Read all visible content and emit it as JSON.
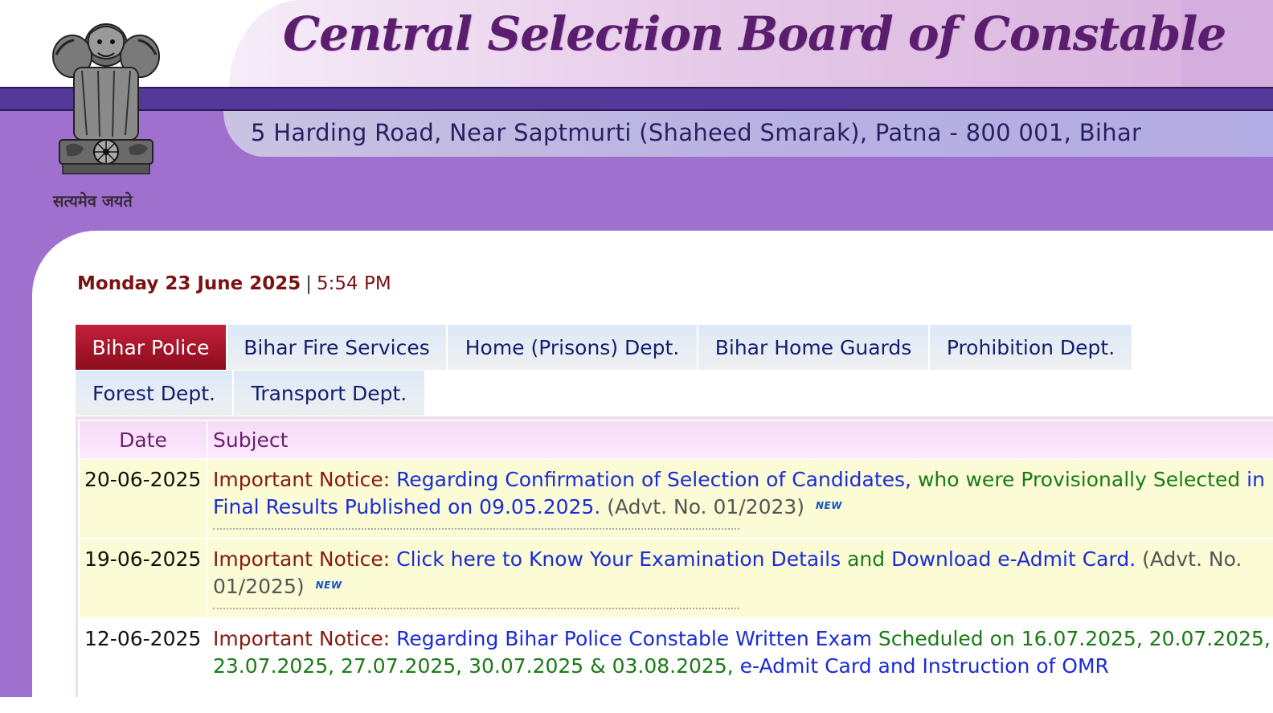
{
  "header": {
    "title": "Central Selection Board of Constable",
    "address": "5 Harding Road, Near Saptmurti (Shaheed Smarak), Patna - 800 001, Bihar",
    "emblem_motto": "सत्यमेव जयते",
    "emblem_icon": "national-emblem-icon"
  },
  "datetime": {
    "day": "Monday 23 June 2025",
    "separator": "|",
    "time": "5:54 PM"
  },
  "tabs": [
    {
      "label": "Bihar Police",
      "active": true
    },
    {
      "label": "Bihar Fire Services",
      "active": false
    },
    {
      "label": "Home (Prisons) Dept.",
      "active": false
    },
    {
      "label": "Bihar Home Guards",
      "active": false
    },
    {
      "label": "Prohibition Dept.",
      "active": false
    },
    {
      "label": "Forest Dept.",
      "active": false
    },
    {
      "label": "Transport Dept.",
      "active": false
    }
  ],
  "table": {
    "headers": {
      "date": "Date",
      "subject": "Subject"
    },
    "rows": [
      {
        "date": "20-06-2025",
        "prefix": "Important Notice:",
        "link1": "Regarding Confirmation of Selection of Candidates,",
        "mid": "who were Provisionally Selected",
        "link2": "in Final Results Published on 09.05.2025.",
        "advt": "(Advt. No. 01/2023)",
        "badge": "NEW"
      },
      {
        "date": "19-06-2025",
        "prefix": "Important Notice:",
        "link1": "Click here to Know Your Examination Details",
        "mid": "and",
        "link2": "Download e-Admit Card.",
        "advt": "(Advt. No. 01/2025)",
        "badge": "NEW"
      },
      {
        "date": "12-06-2025",
        "prefix": "Important Notice:",
        "link1": "Regarding Bihar Police Constable Written Exam",
        "mid": "Scheduled on 16.07.2025, 20.07.2025, 23.07.2025, 27.07.2025, 30.07.2025 & 03.08.2025,",
        "link2": "e-Admit Card and Instruction of OMR"
      }
    ]
  },
  "colors": {
    "brand_purple": "#54389a",
    "lavender": "#a070cf",
    "active_tab": "#a8122a",
    "tab_text": "#14206e",
    "link": "#1a2bd8",
    "notice_prefix": "#8a1a10",
    "highlight_row": "#fbfbd6"
  }
}
